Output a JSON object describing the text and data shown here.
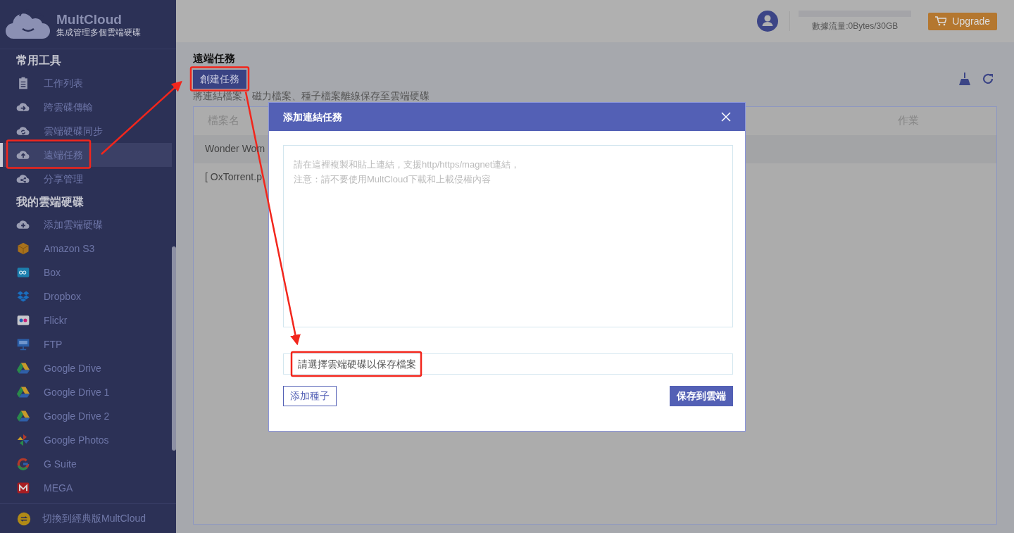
{
  "logo": {
    "name": "MultCloud",
    "tagline": "集成管理多個雲端硬碟"
  },
  "sidebar": {
    "sections": [
      {
        "title": "常用工具",
        "items": [
          {
            "label": "工作列表",
            "selected": false,
            "highlighted": false
          },
          {
            "label": "跨雲碟傳輸",
            "selected": false,
            "highlighted": false
          },
          {
            "label": "雲端硬碟同步",
            "selected": false,
            "highlighted": false
          },
          {
            "label": "遠端任務",
            "selected": true,
            "highlighted": true
          },
          {
            "label": "分享管理",
            "selected": false,
            "highlighted": false
          }
        ]
      },
      {
        "title": "我的雲端硬碟",
        "items": [
          {
            "label": "添加雲端硬碟",
            "selected": false,
            "highlighted": false
          },
          {
            "label": "Amazon S3",
            "selected": false,
            "highlighted": false
          },
          {
            "label": "Box",
            "selected": false,
            "highlighted": false
          },
          {
            "label": "Dropbox",
            "selected": false,
            "highlighted": false
          },
          {
            "label": "Flickr",
            "selected": false,
            "highlighted": false
          },
          {
            "label": "FTP",
            "selected": false,
            "highlighted": false
          },
          {
            "label": "Google Drive",
            "selected": false,
            "highlighted": false
          },
          {
            "label": "Google Drive 1",
            "selected": false,
            "highlighted": false
          },
          {
            "label": "Google Drive 2",
            "selected": false,
            "highlighted": false
          },
          {
            "label": "Google Photos",
            "selected": false,
            "highlighted": false
          },
          {
            "label": "G Suite",
            "selected": false,
            "highlighted": false
          },
          {
            "label": "MEGA",
            "selected": false,
            "highlighted": false
          }
        ]
      }
    ],
    "footer": "切換到經典版MultCloud"
  },
  "header": {
    "traffic": "數據流量:0Bytes/30GB",
    "upgrade": "Upgrade"
  },
  "page": {
    "title": "遠端任務",
    "create_button": {
      "label": "創建任務",
      "highlighted": true
    },
    "description": "將連結檔案、磁力檔案、種子檔案離線保存至雲端硬碟",
    "table": {
      "columns": [
        "檔案名",
        "作業"
      ],
      "rows": [
        [
          "Wonder Wom"
        ],
        [
          "[ OxTorrent.p"
        ]
      ]
    }
  },
  "modal": {
    "title": "添加連結任務",
    "link_placeholder": "請在這裡複製和貼上連結，支援http/https/magnet連結，注意：請不要使用MultCloud下載和上載侵權內容",
    "save_field": {
      "placeholder": "請選擇雲端硬碟以保存檔案",
      "highlighted": true
    },
    "buttons": [
      "添加種子",
      "保存到雲端"
    ]
  }
}
